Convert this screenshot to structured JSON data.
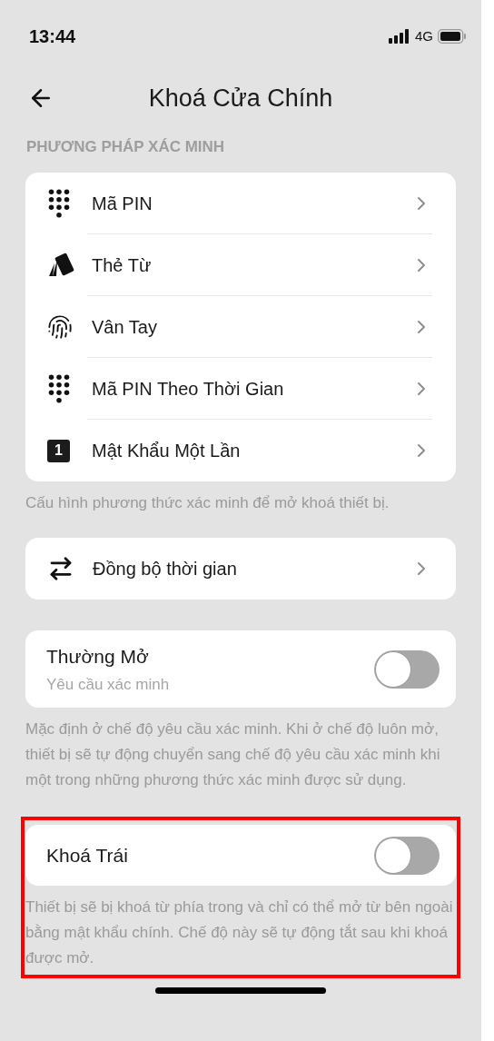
{
  "status_bar": {
    "time": "13:44",
    "network": "4G"
  },
  "header": {
    "title": "Khoá Cửa Chính"
  },
  "methods": {
    "heading": "PHƯƠNG PHÁP XÁC MINH",
    "items": [
      {
        "kind": "keypad",
        "label": "Mã PIN"
      },
      {
        "kind": "card",
        "label": "Thẻ Từ"
      },
      {
        "kind": "fingerprint",
        "label": "Vân Tay"
      },
      {
        "kind": "keypad",
        "label": "Mã PIN Theo Thời Gian"
      },
      {
        "kind": "number",
        "label": "Mật Khẩu Một Lần",
        "icon_text": "1"
      }
    ],
    "note": "Cấu hình phương thức xác minh để mở khoá thiết bị."
  },
  "sync": {
    "label": "Đồng bộ thời gian"
  },
  "toggles": [
    {
      "label": "Thường Mở",
      "subtitle": "Yêu cầu xác minh",
      "on": false,
      "highlighted": false,
      "note": "Mặc định ở chế độ yêu cầu xác minh. Khi ở chế độ luôn mở, thiết bị sẽ tự động chuyển sang chế độ yêu cầu xác minh khi một trong những phương thức xác minh được sử dụng."
    },
    {
      "label": "Khoá Trái",
      "on": false,
      "highlighted": true,
      "note": "Thiết bị sẽ bị khoá từ phía trong và chỉ có thể mở từ bên ngoài bằng mật khẩu chính. Chế độ này sẽ tự động tắt sau khi khoá được mở."
    }
  ]
}
